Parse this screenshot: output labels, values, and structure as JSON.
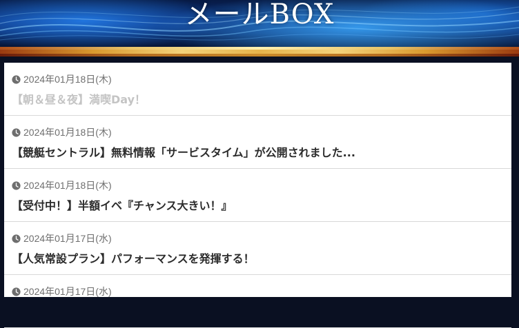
{
  "header": {
    "title": "メールBOX"
  },
  "mails": [
    {
      "date": "2024年01月18日(木)",
      "title": "【朝＆昼＆夜】満喫Day！",
      "read": true
    },
    {
      "date": "2024年01月18日(木)",
      "title": "【競艇セントラル】無料情報「サービスタイム」が公開されました...",
      "read": false
    },
    {
      "date": "2024年01月18日(木)",
      "title": "【受付中！】半額イベ『チャンス大きい！』",
      "read": false
    },
    {
      "date": "2024年01月17日(水)",
      "title": "【人気常設プラン】パフォーマンスを発揮する！",
      "read": false
    },
    {
      "date": "2024年01月17日(水)",
      "title": "",
      "read": false
    }
  ],
  "icons": {
    "date_icon": "clock-icon"
  },
  "colors": {
    "read_title": "#c4c4c4",
    "unread_title": "#2b2b2b",
    "date_text": "#6e6e6e"
  }
}
